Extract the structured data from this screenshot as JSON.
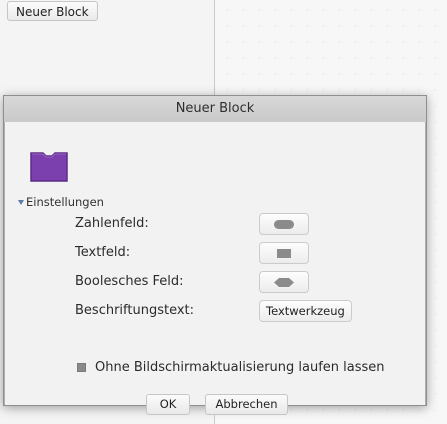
{
  "background": {
    "button_label": "Neuer Block"
  },
  "dialog": {
    "title": "Neuer Block",
    "block_color": "#7b3fae",
    "settings_label": "Einstellungen",
    "rows": {
      "number": {
        "label": "Zahlenfeld:",
        "icon": "rounded-slot-icon"
      },
      "text": {
        "label": "Textfeld:",
        "icon": "rect-slot-icon"
      },
      "boolean": {
        "label": "Boolesches Feld:",
        "icon": "hexagon-slot-icon"
      },
      "caption": {
        "label": "Beschriftungstext:",
        "button": "Textwerkzeug"
      }
    },
    "checkbox_label": "Ohne Bildschirmaktualisierung laufen lassen",
    "ok_label": "OK",
    "cancel_label": "Abbrechen"
  }
}
